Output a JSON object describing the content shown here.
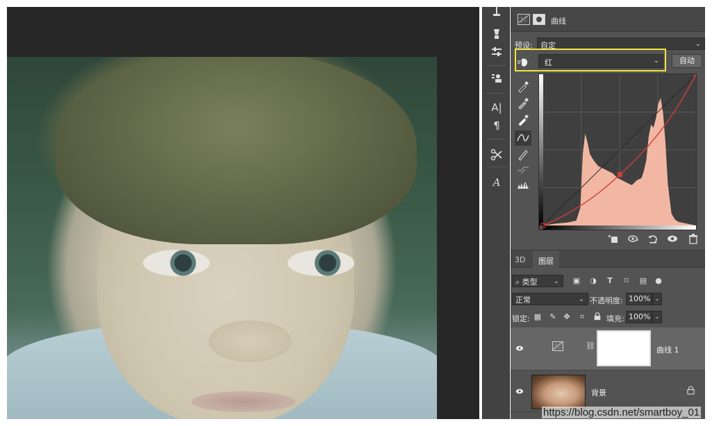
{
  "properties": {
    "title": "曲线",
    "preset_label": "预设:",
    "preset_value": "自定",
    "channel_value": "红",
    "auto_label": "自动"
  },
  "curve": {
    "points": [
      [
        0,
        0
      ],
      [
        128,
        86
      ],
      [
        255,
        255
      ]
    ],
    "curve_color": "#d0403a",
    "histogram_color": "#f2b7a2",
    "highlight_color": "#f3e43a"
  },
  "layers_panel": {
    "tabs": [
      "3D",
      "图层"
    ],
    "active_tab": "图层",
    "filter_label": "类型",
    "blend_mode": "正常",
    "opacity_label": "不透明度:",
    "opacity_value": "100%",
    "lock_label": "锁定:",
    "fill_label": "填充:",
    "fill_value": "100%",
    "layers": [
      {
        "name": "曲线 1",
        "type": "adjustment",
        "visible": true,
        "selected": true
      },
      {
        "name": "背景",
        "type": "image",
        "visible": true,
        "locked": true
      }
    ]
  },
  "watermark": "https://blog.csdn.net/smartboy_01"
}
